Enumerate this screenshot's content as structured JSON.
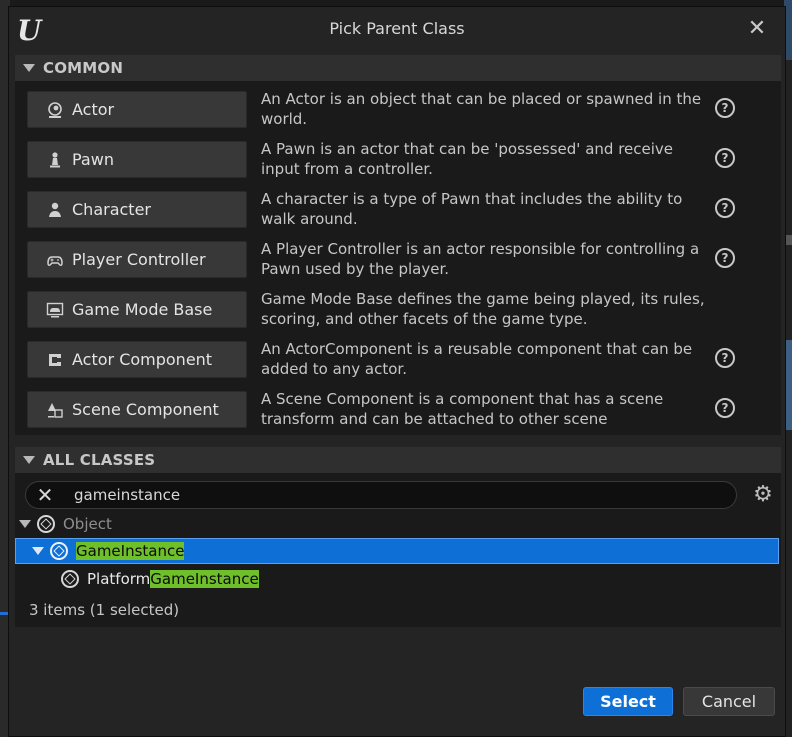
{
  "dialog": {
    "title": "Pick Parent Class",
    "logo_icon": "unreal-logo-icon",
    "close_icon": "close-icon"
  },
  "common": {
    "header": "COMMON",
    "items": [
      {
        "label": "Actor",
        "icon": "actor-icon",
        "description": "An Actor is an object that can be placed or spawned in the world."
      },
      {
        "label": "Pawn",
        "icon": "pawn-icon",
        "description": "A Pawn is an actor that can be 'possessed' and receive input from a controller."
      },
      {
        "label": "Character",
        "icon": "character-icon",
        "description": "A character is a type of Pawn that includes the ability to walk around."
      },
      {
        "label": "Player Controller",
        "icon": "gamepad-icon",
        "description": "A Player Controller is an actor responsible for controlling a Pawn used by the player."
      },
      {
        "label": "Game Mode Base",
        "icon": "game-mode-icon",
        "description": "Game Mode Base defines the game being played, its rules, scoring, and other facets of the game type."
      },
      {
        "label": "Actor Component",
        "icon": "actor-component-icon",
        "description": "An ActorComponent is a reusable component that can be added to any actor."
      },
      {
        "label": "Scene Component",
        "icon": "scene-component-icon",
        "description": "A Scene Component is a component that has a scene transform and can be attached to other scene"
      }
    ]
  },
  "all_classes": {
    "header": "ALL CLASSES",
    "search_value": "gameinstance",
    "tree": {
      "root": "Object",
      "selected_label": "GameInstance",
      "child_prefix": "Platform",
      "child_match": "GameInstance"
    },
    "item_count": "3 items (1 selected)"
  },
  "buttons": {
    "select": "Select",
    "cancel": "Cancel"
  },
  "colors": {
    "accent": "#0e6fd6",
    "match_highlight": "#6fbf2a"
  }
}
